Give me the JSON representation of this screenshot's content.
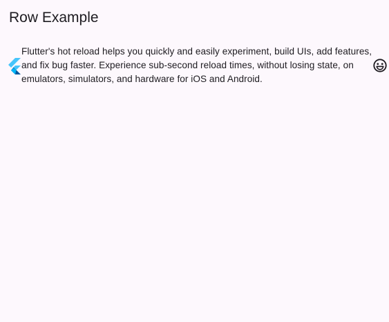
{
  "app_bar": {
    "title": "Row Example"
  },
  "row": {
    "leading_icon": "flutter-logo",
    "text": "Flutter's hot reload helps you quickly and easily experiment, build UIs, add features, and fix bug faster. Experience sub-second reload times, without losing state, on emulators, simulators, and hardware for iOS and Android.",
    "trailing_icon": "sentiment-very-satisfied-icon"
  },
  "colors": {
    "background": "#fdf8fd",
    "text": "#1d1b20",
    "flutter_light_blue": "#47c5fb",
    "flutter_dark_blue": "#00569e",
    "flutter_mid_blue": "#00b5f8"
  }
}
